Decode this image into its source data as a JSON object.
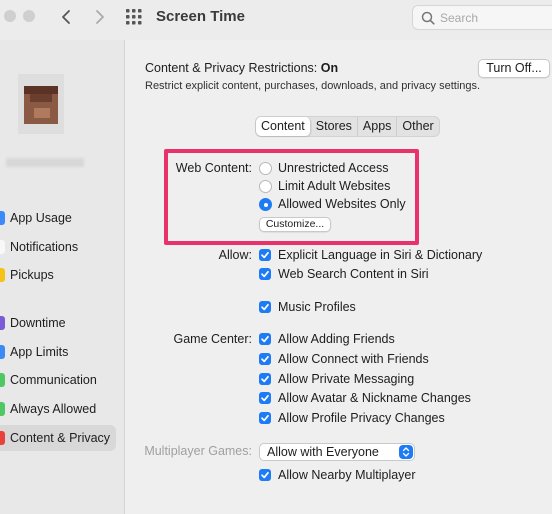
{
  "window": {
    "title": "Screen Time"
  },
  "search": {
    "placeholder": "Search"
  },
  "sidebar": {
    "items": [
      {
        "label": "App Usage",
        "icon": "app-usage-icon",
        "color": "#3a8bf7"
      },
      {
        "label": "Notifications",
        "icon": "notifications-icon",
        "color": "#ffffff"
      },
      {
        "label": "Pickups",
        "icon": "pickups-icon",
        "color": "#f5c318"
      },
      {
        "label": "Downtime",
        "icon": "downtime-icon",
        "color": "#7a5ad6"
      },
      {
        "label": "App Limits",
        "icon": "app-limits-icon",
        "color": "#3a8bf7"
      },
      {
        "label": "Communication",
        "icon": "communication-icon",
        "color": "#4fc864"
      },
      {
        "label": "Always Allowed",
        "icon": "always-allowed-icon",
        "color": "#4fc864"
      },
      {
        "label": "Content & Privacy",
        "icon": "content-privacy-icon",
        "color": "#e9413b"
      }
    ]
  },
  "main": {
    "header_prefix": "Content & Privacy Restrictions: ",
    "header_status": "On",
    "turn_off_label": "Turn Off...",
    "description": "Restrict explicit content, purchases, downloads, and privacy settings.",
    "tabs": [
      {
        "label": "Content"
      },
      {
        "label": "Stores"
      },
      {
        "label": "Apps"
      },
      {
        "label": "Other"
      }
    ],
    "active_tab": "Content",
    "web_content": {
      "label": "Web Content:",
      "options": [
        {
          "label": "Unrestricted Access",
          "selected": false
        },
        {
          "label": "Limit Adult Websites",
          "selected": false
        },
        {
          "label": "Allowed Websites Only",
          "selected": true
        }
      ],
      "customize_label": "Customize..."
    },
    "allow": {
      "label": "Allow:",
      "items": [
        {
          "label": "Explicit Language in Siri & Dictionary",
          "checked": true
        },
        {
          "label": "Web Search Content in Siri",
          "checked": true
        },
        {
          "label": "Music Profiles",
          "checked": true
        }
      ]
    },
    "game_center": {
      "label": "Game Center:",
      "items": [
        {
          "label": "Allow Adding Friends",
          "checked": true
        },
        {
          "label": "Allow Connect with Friends",
          "checked": true
        },
        {
          "label": "Allow Private Messaging",
          "checked": true
        },
        {
          "label": "Allow Avatar & Nickname Changes",
          "checked": true
        },
        {
          "label": "Allow Profile Privacy Changes",
          "checked": true
        }
      ]
    },
    "multiplayer": {
      "label": "Multiplayer Games:",
      "value": "Allow with Everyone",
      "nearby_label": "Allow Nearby Multiplayer",
      "nearby_checked": true
    },
    "accent": "#1d7bf5",
    "highlight_color": "#e9326b"
  }
}
